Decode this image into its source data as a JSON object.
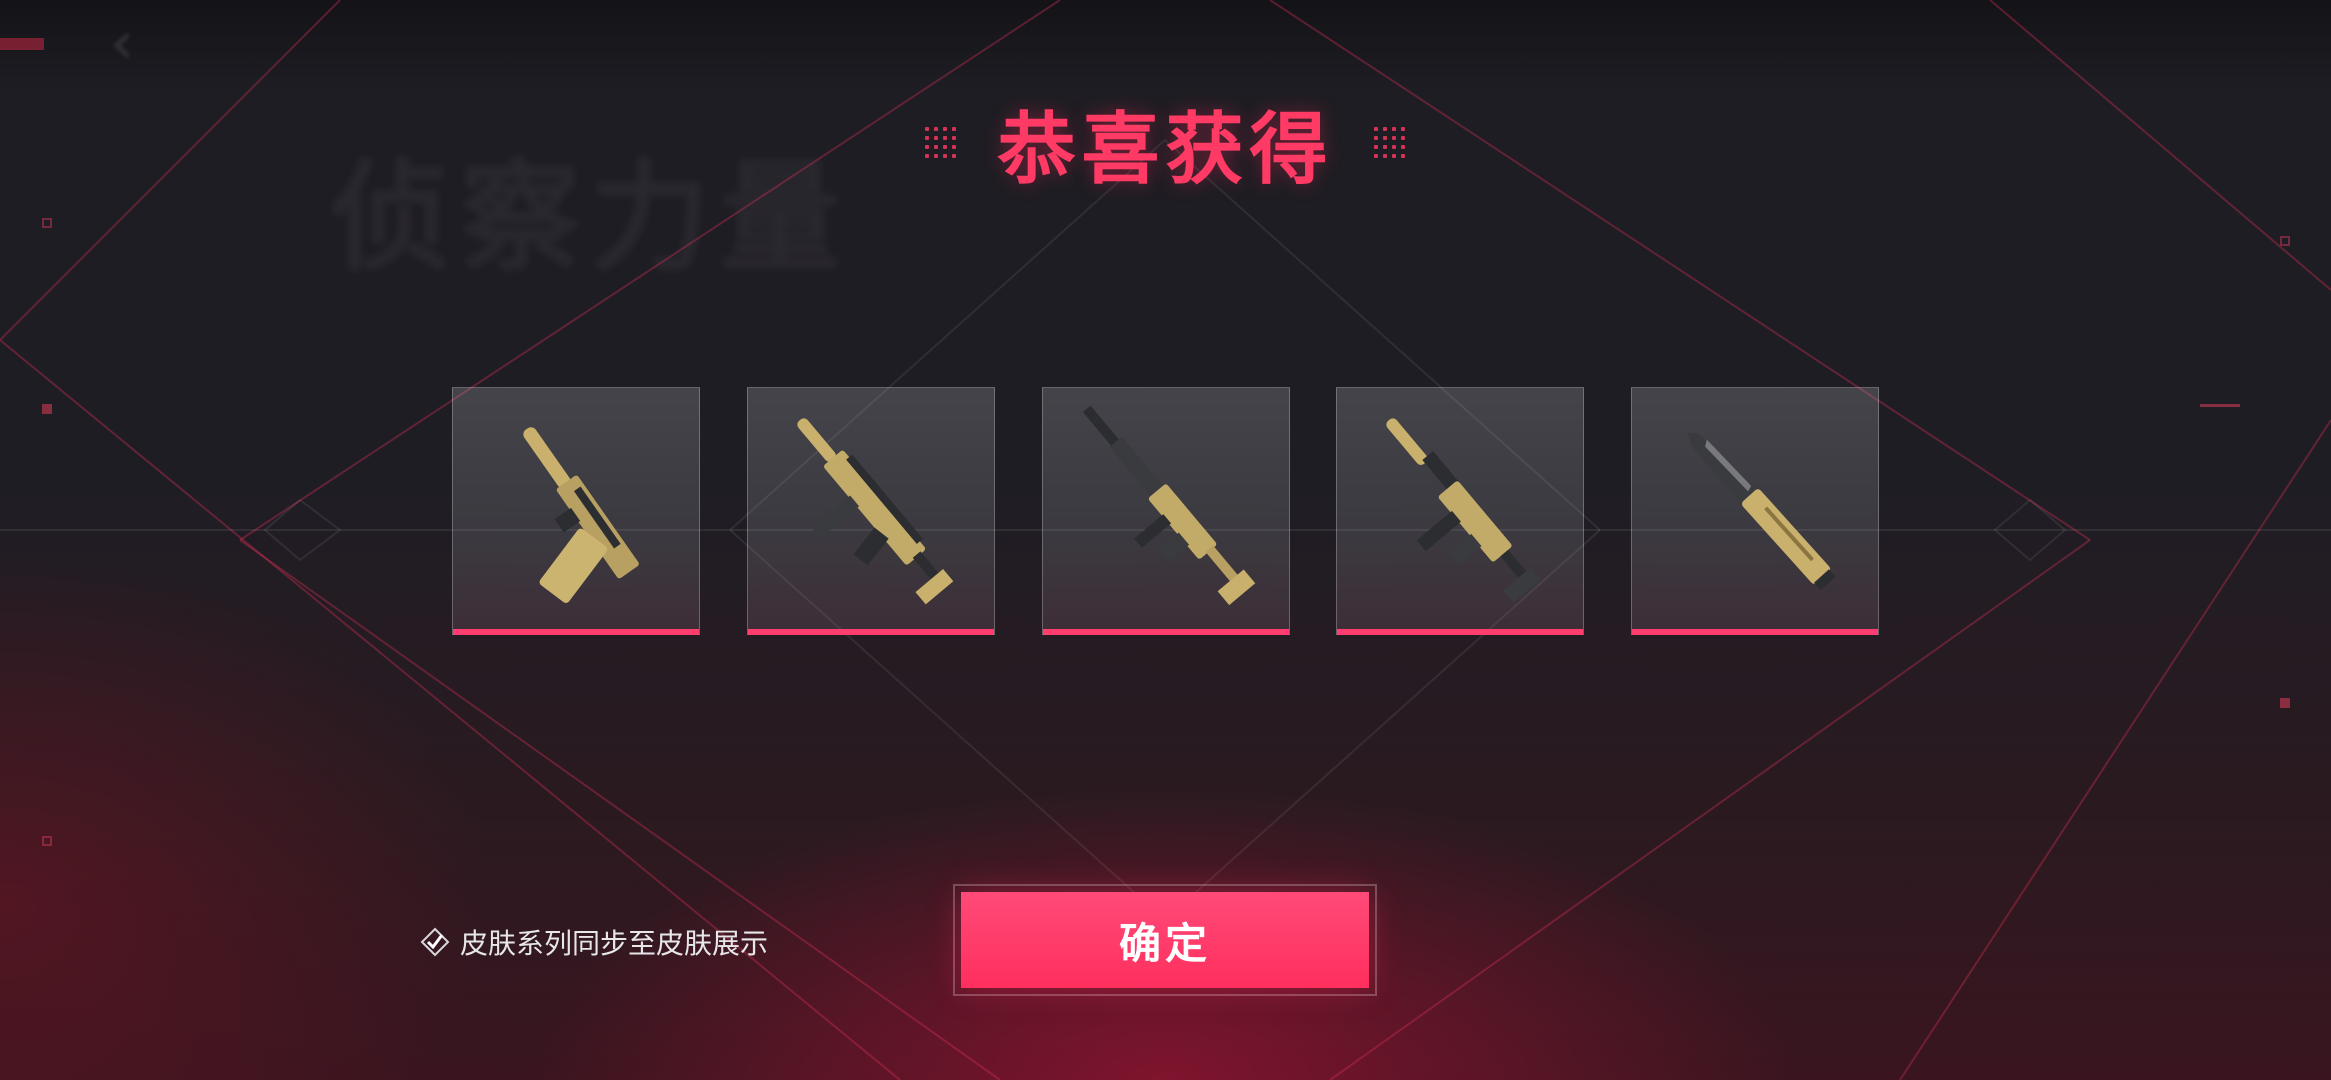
{
  "dialog": {
    "title": "恭喜获得",
    "background_watermark": "侦察力量"
  },
  "rewards": [
    {
      "name": "pistol-skin",
      "icon": "pistol-icon"
    },
    {
      "name": "smg-skin-1",
      "icon": "smg-icon"
    },
    {
      "name": "rifle-skin",
      "icon": "rifle-icon"
    },
    {
      "name": "smg-skin-2",
      "icon": "smg-icon"
    },
    {
      "name": "knife-skin",
      "icon": "knife-icon"
    }
  ],
  "sync_option": {
    "label": "皮肤系列同步至皮肤展示",
    "checked": true
  },
  "confirm": {
    "label": "确定"
  },
  "colors": {
    "accent": "#ff3a64",
    "button": "#ff3d6e",
    "weapon_gold": "#c9b06c",
    "weapon_dark": "#2c2d30"
  }
}
